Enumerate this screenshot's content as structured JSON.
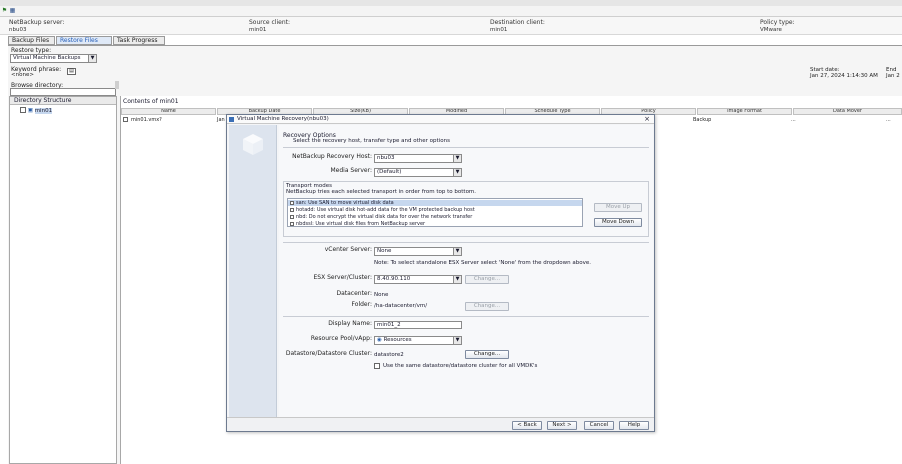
{
  "toolbar": {
    "icons": [
      "green-flag-icon",
      "grid-icon"
    ]
  },
  "info": {
    "netbackup_server_label": "NetBackup server:",
    "netbackup_server_value": "nbu03",
    "source_client_label": "Source client:",
    "source_client_value": "min01",
    "destination_client_label": "Destination client:",
    "destination_client_value": "min01",
    "policy_type_label": "Policy type:",
    "policy_type_value": "VMware"
  },
  "tabs": [
    {
      "label": "Backup Files"
    },
    {
      "label": "Restore Files"
    },
    {
      "label": "Task Progress"
    }
  ],
  "restore": {
    "restore_type_label": "Restore type:",
    "restore_type_value": "Virtual Machine Backups",
    "keyword_label": "Keyword phrase:",
    "keyword_value": "<none>",
    "browse_label": "Browse directory:",
    "start_date_label": "Start date:",
    "start_date_value": "Jan 27, 2024 1:14:30 AM",
    "end_label": "End",
    "end_value": "Jan 2"
  },
  "directory": {
    "header": "Directory Structure",
    "tree_item": "min01"
  },
  "contents": {
    "title": "Contents of min01",
    "columns": [
      "Name",
      "Backup Date",
      "Size(KB)",
      "Modified",
      "Schedule Type",
      "Policy",
      "Image Format",
      "Data Mover"
    ],
    "row": {
      "name": "min01.vmx?",
      "date": "Jan",
      "policy": "Backup",
      "image_format": "...",
      "data_mover": "..."
    }
  },
  "dialog": {
    "title": "Virtual Machine Recovery(nbu03)",
    "heading": "Recovery Options",
    "subheading": "Select the recovery host, transfer type and other options",
    "recovery_host_label": "NetBackup Recovery Host:",
    "recovery_host_value": "nbu03",
    "media_server_label": "Media Server:",
    "media_server_value": "(Default)",
    "transport_title": "Transport modes",
    "transport_desc": "NetBackup tries each selected transport in order from top to bottom.",
    "transport_items": [
      "san: Use SAN to move virtual disk data",
      "hotadd: Use virtual disk hot-add data for the VM protected backup host",
      "nbd: Do not encrypt the virtual disk data for over the network transfer",
      "nbdssl: Use virtual disk files from NetBackup server"
    ],
    "move_up": "Move Up",
    "move_down": "Move Down",
    "vcenter_label": "vCenter Server:",
    "vcenter_value": "None",
    "note": "Note: To select standalone ESX Server select 'None' from the dropdown above.",
    "esx_label": "ESX Server/Cluster:",
    "esx_value": "8.40.90.110",
    "change1": "Change...",
    "datacenter_label": "Datacenter:",
    "datacenter_value": "None",
    "folder_label": "Folder:",
    "folder_value": "/ha-datacenter/vm/",
    "change2": "Change...",
    "display_name_label": "Display Name:",
    "display_name_value": "min01_2",
    "resource_pool_label": "Resource Pool/vApp:",
    "resource_pool_value": "Resources",
    "datastore_label": "Datastore/Datastore Cluster:",
    "datastore_value": "datastore2",
    "change3": "Change...",
    "same_datastore_label": "Use the same datastore/datastore cluster for all VMDK's",
    "back": "< Back",
    "next": "Next >",
    "cancel": "Cancel",
    "help": "Help"
  }
}
